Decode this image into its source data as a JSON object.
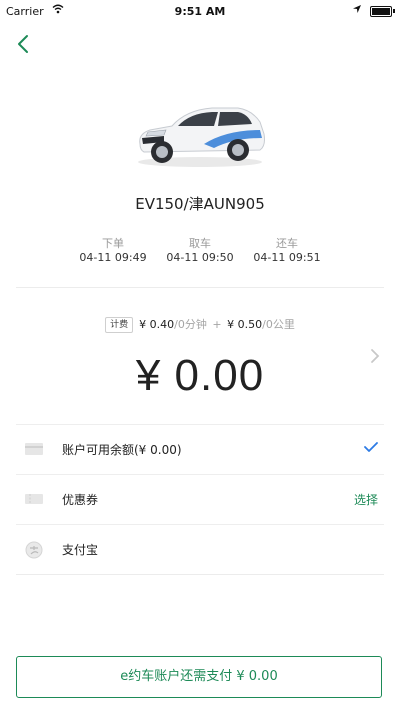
{
  "status_bar": {
    "carrier": "Carrier",
    "time": "9:51 AM"
  },
  "car": {
    "title": "EV150/津AUN905"
  },
  "timeline": [
    {
      "label": "下单",
      "value": "04-11 09:49"
    },
    {
      "label": "取车",
      "value": "04-11 09:50"
    },
    {
      "label": "还车",
      "value": "04-11 09:51"
    }
  ],
  "pricing": {
    "tag": "计费",
    "time_price": "¥ 0.40",
    "time_unit": "/0分钟",
    "plus": "+",
    "distance_price": "¥ 0.50",
    "distance_unit": "/0公里"
  },
  "total": "¥ 0.00",
  "payment_methods": [
    {
      "label": "账户可用余额(¥ 0.00)",
      "right": "✓",
      "selected": true
    },
    {
      "label": "优惠券",
      "right": "选择",
      "selected": false
    },
    {
      "label": "支付宝",
      "right": "",
      "selected": false
    }
  ],
  "pay_button": "e约车账户还需支付 ¥ 0.00",
  "colors": {
    "accent": "#1d8a57",
    "check": "#2d7be5",
    "muted": "#9a9a9a"
  },
  "icons": {
    "back": "chevron-left-icon",
    "more": "chevron-right-icon",
    "balance": "card-icon",
    "coupon": "coupon-icon",
    "alipay": "alipay-icon",
    "check": "checkmark-icon"
  }
}
